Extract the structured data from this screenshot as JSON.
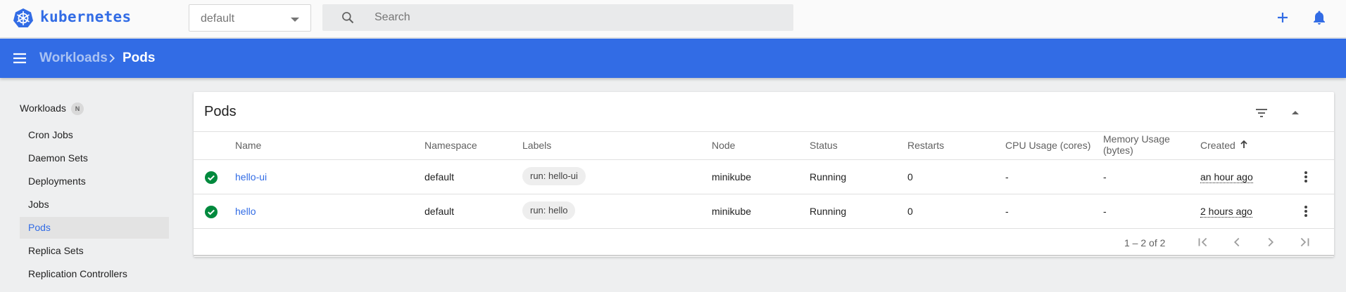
{
  "app": {
    "brand": "kubernetes"
  },
  "toolbar": {
    "namespace": "default",
    "search_placeholder": "Search"
  },
  "breadcrumb": {
    "parent": "Workloads",
    "current": "Pods"
  },
  "sidebar": {
    "section": "Workloads",
    "badge": "N",
    "items": [
      {
        "label": "Cron Jobs",
        "active": false
      },
      {
        "label": "Daemon Sets",
        "active": false
      },
      {
        "label": "Deployments",
        "active": false
      },
      {
        "label": "Jobs",
        "active": false
      },
      {
        "label": "Pods",
        "active": true
      },
      {
        "label": "Replica Sets",
        "active": false
      },
      {
        "label": "Replication Controllers",
        "active": false
      }
    ]
  },
  "pods": {
    "title": "Pods",
    "columns": {
      "name": "Name",
      "namespace": "Namespace",
      "labels": "Labels",
      "node": "Node",
      "status": "Status",
      "restarts": "Restarts",
      "cpu": "CPU Usage (cores)",
      "memory_line1": "Memory Usage",
      "memory_line2": "(bytes)",
      "created": "Created"
    },
    "rows": [
      {
        "name": "hello-ui",
        "namespace": "default",
        "label": "run: hello-ui",
        "node": "minikube",
        "status": "Running",
        "restarts": "0",
        "cpu": "-",
        "memory": "-",
        "created": "an hour ago"
      },
      {
        "name": "hello",
        "namespace": "default",
        "label": "run: hello",
        "node": "minikube",
        "status": "Running",
        "restarts": "0",
        "cpu": "-",
        "memory": "-",
        "created": "2 hours ago"
      }
    ],
    "paging": "1 – 2 of 2"
  },
  "colors": {
    "primary": "#326ce5",
    "success": "#00893d",
    "background": "#eeeff0"
  }
}
